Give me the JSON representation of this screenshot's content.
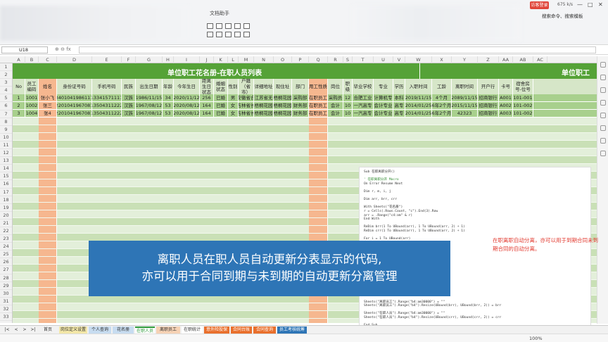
{
  "app": {
    "title": "文档助手",
    "user_btn": "访客登录",
    "speed": "675 k/s",
    "search_cmd": "搜索命令、搜索模板"
  },
  "formula_bar": {
    "cell_ref": "U18",
    "fx": "fx"
  },
  "columns": [
    "A",
    "B",
    "C",
    "D",
    "E",
    "F",
    "G",
    "H",
    "I",
    "J",
    "K",
    "L",
    "M",
    "N",
    "O",
    "P",
    "Q",
    "R",
    "S",
    "T",
    "U",
    "V",
    "W",
    "X",
    "Y",
    "Z",
    "AA",
    "AB",
    "AC"
  ],
  "rows": [
    "1",
    "2",
    "3",
    "4",
    "5",
    "6",
    "7",
    "8",
    "9",
    "10",
    "11",
    "12",
    "13",
    "14",
    "15",
    "16",
    "17",
    "18",
    "19",
    "20",
    "21",
    "22",
    "23",
    "24",
    "25",
    "26",
    "27",
    "28",
    "29",
    "30",
    "31",
    "32",
    "33"
  ],
  "sheet": {
    "title_left": "单位职工花名册-在职人员列表",
    "title_right": "单位职工",
    "headers": [
      "No",
      "员工编码",
      "姓名",
      "身份证号码",
      "手机号码",
      "民族",
      "出生日期",
      "年龄",
      "今年生日",
      "距离生日状态",
      "婚姻状态",
      "性别",
      "户籍（省市）",
      "详细地址",
      "现住址",
      "部门",
      "用工性质",
      "岗位",
      "职级",
      "毕业学校",
      "专业",
      "学历",
      "入职时间",
      "工龄",
      "离职时间",
      "开户行",
      "卡号",
      "宿舍房号-位号"
    ],
    "data": [
      [
        "1",
        "1001",
        "张小飞",
        "3401041986111",
        "13341571111",
        "汉族",
        "1986/11/15",
        "34",
        "2020/11/12",
        "256",
        "已婚",
        "男",
        "安徽省合",
        "江苏省无",
        "梧桐花园",
        "采购部",
        "在职员工",
        "采购员",
        "12",
        "合肥工业",
        "计算机专",
        "本科",
        "2019/11/15",
        "4个月",
        "2089/11/15",
        "招商银行",
        "A001",
        "101-001"
      ],
      [
        "2",
        "1002",
        "张三",
        "2201041967081",
        "13504311222",
        "汉族",
        "1967/08/12",
        "53",
        "2020/08/12",
        "164",
        "已婚",
        "女",
        "吉林省长",
        "梧桐花园",
        "梧桐花园",
        "财务部",
        "在职员工",
        "会计",
        "10",
        "一汽高专",
        "会计专业",
        "高专",
        "2014/01/25",
        "6年2个月",
        "2015/11/15",
        "招商银行",
        "A002",
        "101-002"
      ],
      [
        "3",
        "1004",
        "张4",
        "2201041967081",
        "13504311222",
        "汉族",
        "1967/08/12",
        "53",
        "2020/08/12",
        "164",
        "已婚",
        "女",
        "吉林省长",
        "梧桐花园",
        "梧桐花园",
        "财务部",
        "在职员工",
        "会计",
        "10",
        "一汽高专",
        "会计专业",
        "高专",
        "2014/01/25",
        "6年2个月",
        "42323",
        "招商银行",
        "A003",
        "101-002"
      ]
    ]
  },
  "code": [
    "Sub 在职离职分开()",
    "",
    "'  在职离职分开 Macro",
    "On Error Resume Next",
    "",
    "Dim r, m, i, j",
    "",
    "Dim arr, brr, crr",
    "",
    "With Sheets(\"花名册\")",
    "    r = Cells(.Rows.Count, \"c\").End(3).Row",
    "    arr = .Range(\"c4:am\" & r)",
    "End With",
    "",
    "ReDim brr(1 To UBound(arr), 1 To UBound(arr, 2) + 1)",
    "ReDim crr(1 To UBound(arr), 1 To UBound(arr, 2) + 1)",
    "",
    "For i = 1 To UBound(arr)",
    "",
    "",
    "",
    "",
    "",
    "",
    "",
    "",
    "",
    "",
    "",
    "",
    "",
    "Next",
    "",
    "  Sheets(\"离职员工\").Range(\"b4:am30000\") = \"\"",
    "  Sheets(\"离职员工\").Range(\"b4\").Resize(UBound(brr), UBound(brr, 2)) = brr",
    "",
    "  Sheets(\"在职人员\").Range(\"b4:am30000\") = \"\"",
    "  Sheets(\"在职人员\").Range(\"b4\").Resize(UBound(crr), UBound(crr, 2)) = crr",
    "",
    "End Sub"
  ],
  "note": "在职离职自动分离，亦可以用于到期合同未到期合同的自动分离。",
  "caption": [
    "离职人员在职人员自动更新分表显示的代码,",
    "亦可以用于合同到期与未到期的自动更新分离管理"
  ],
  "tabs": [
    "首页",
    "岗位定义设置",
    "个人查询",
    "花名册",
    "在职人员",
    "离职员工",
    "在职统计",
    "意外险投保",
    "合同台账",
    "合同查询",
    "员工考核统筹"
  ],
  "status": {
    "zoom": "100%"
  }
}
